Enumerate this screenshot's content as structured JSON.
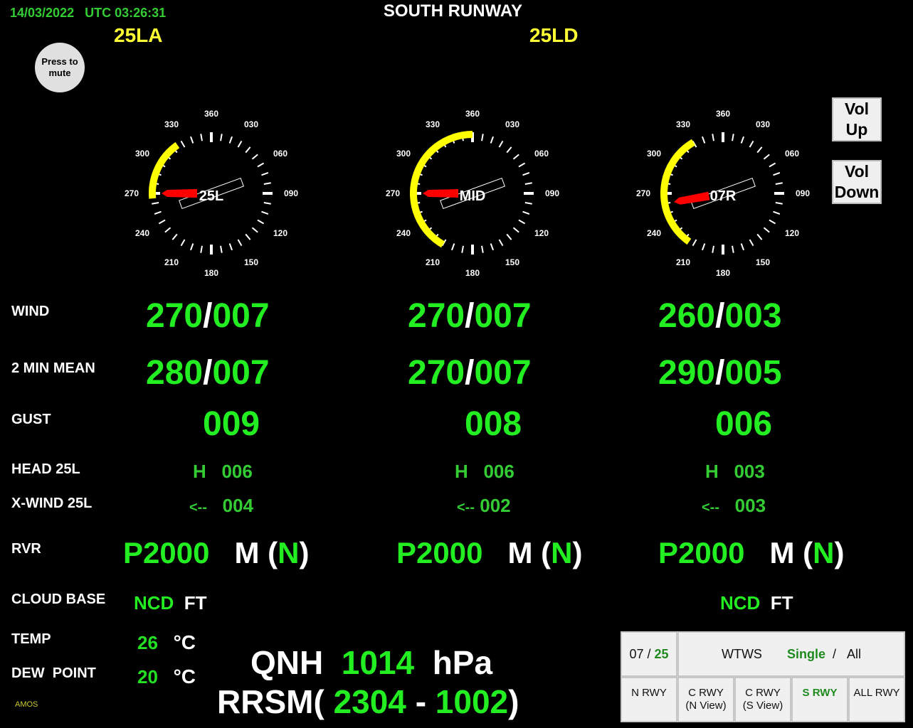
{
  "header": {
    "date": "14/03/2022",
    "time_label": "UTC 03:26:31",
    "title": "SOUTH RUNWAY",
    "arrival_runway": "25LA",
    "departure_runway": "25LD"
  },
  "controls": {
    "mute_label_1": "Press to",
    "mute_label_2": "mute",
    "vol_up_1": "Vol",
    "vol_up_2": "Up",
    "vol_down_1": "Vol",
    "vol_down_2": "Down"
  },
  "dial_scale": [
    "360",
    "030",
    "060",
    "090",
    "120",
    "150",
    "180",
    "210",
    "240",
    "270",
    "300",
    "330"
  ],
  "sensors": [
    {
      "name": "25L",
      "wind_dir": 270,
      "variability_from": 265,
      "variability_to": 325,
      "runway_heading": 250,
      "wind": {
        "dir": "270",
        "speed": "007"
      },
      "mean": {
        "dir": "280",
        "speed": "007"
      },
      "gust": "009",
      "head": {
        "prefix": "H",
        "value": "006"
      },
      "xwind": {
        "prefix": "<--",
        "value": "004"
      },
      "rvr": {
        "value": "P2000",
        "unit": "M",
        "open": "(",
        "trend": "N",
        "close": ")"
      }
    },
    {
      "name": "MID",
      "wind_dir": 270,
      "variability_from": 210,
      "variability_to": 360,
      "runway_heading": 250,
      "wind": {
        "dir": "270",
        "speed": "007"
      },
      "mean": {
        "dir": "270",
        "speed": "007"
      },
      "gust": "008",
      "head": {
        "prefix": "H",
        "value": "006"
      },
      "xwind": {
        "prefix": "<--",
        "value": "002"
      },
      "rvr": {
        "value": "P2000",
        "unit": "M",
        "open": "(",
        "trend": "N",
        "close": ")"
      }
    },
    {
      "name": "07R",
      "wind_dir": 260,
      "variability_from": 215,
      "variability_to": 330,
      "runway_heading": 250,
      "wind": {
        "dir": "260",
        "speed": "003"
      },
      "mean": {
        "dir": "290",
        "speed": "005"
      },
      "gust": "006",
      "head": {
        "prefix": "H",
        "value": "003"
      },
      "xwind": {
        "prefix": "<--",
        "value": "003"
      },
      "rvr": {
        "value": "P2000",
        "unit": "M",
        "open": "(",
        "trend": "N",
        "close": ")"
      }
    }
  ],
  "labels": {
    "wind": "WIND",
    "mean": "2 MIN MEAN",
    "gust": "GUST",
    "head": "HEAD 25L",
    "xwind": "X-WIND 25L",
    "rvr": "RVR",
    "cloud": "CLOUD BASE",
    "temp": "TEMP",
    "dew": "DEW  POINT",
    "slash": "/"
  },
  "cloud": [
    {
      "value": "NCD",
      "unit": "FT"
    },
    {
      "value": "NCD",
      "unit": "FT"
    }
  ],
  "temp": {
    "value": "26",
    "unit": "°C"
  },
  "dew": {
    "value": "20",
    "unit": "°C"
  },
  "qnh": {
    "label": "QNH",
    "value": "1014",
    "unit": "hPa"
  },
  "rrsm": {
    "label": "RRSM",
    "open": "(",
    "from": "2304",
    "dash": "-",
    "to": "1002",
    "close": ")"
  },
  "footer_tag": "AMOS",
  "panel": {
    "rwy_07": "07 /",
    "rwy_25": "25",
    "wtws": "WTWS",
    "single": "Single",
    "slash": "/",
    "all": "All",
    "buttons": [
      {
        "l1": "N RWY",
        "l2": ""
      },
      {
        "l1": "C RWY",
        "l2": "(N View)"
      },
      {
        "l1": "C RWY",
        "l2": "(S View)"
      },
      {
        "l1": "S RWY",
        "l2": ""
      },
      {
        "l1": "ALL RWY",
        "l2": ""
      }
    ],
    "colors": {
      "selected": "#1e8a1e"
    }
  },
  "colors": {
    "value_green": "#22ee22",
    "runway_yellow": "#ffff33",
    "variability_arc": "#ffff00",
    "wind_arrow": "#ff0000"
  }
}
